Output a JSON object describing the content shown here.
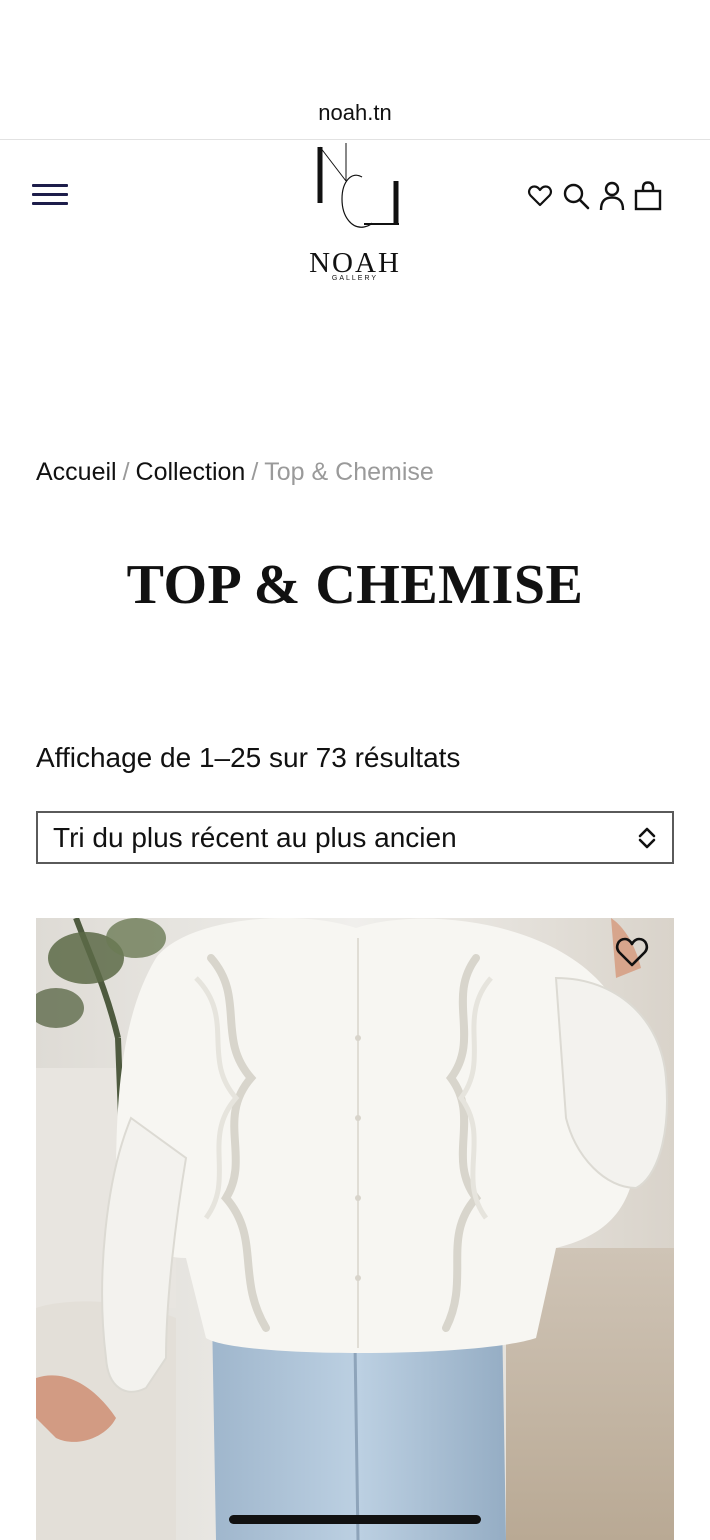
{
  "browser": {
    "url": "noah.tn"
  },
  "header": {
    "logo": {
      "mark": "NG",
      "word": "NOAH",
      "sub": "GALLERY"
    },
    "icons": [
      "menu-icon",
      "heart-icon",
      "search-icon",
      "user-icon",
      "bag-icon"
    ]
  },
  "breadcrumb": {
    "home": "Accueil",
    "collection": "Collection",
    "current": "Top & Chemise",
    "separator": "/"
  },
  "page": {
    "title": "TOP & CHEMISE",
    "results": "Affichage de 1–25 sur 73 résultats"
  },
  "sort": {
    "selected": "Tri du plus récent au plus ancien"
  },
  "products": [
    {
      "image": "white-ruffle-blouse",
      "wishlist_icon": "heart-icon"
    }
  ],
  "colors": {
    "menu": "#1d1d4a",
    "text": "#111111",
    "muted": "#9a9a9a"
  }
}
